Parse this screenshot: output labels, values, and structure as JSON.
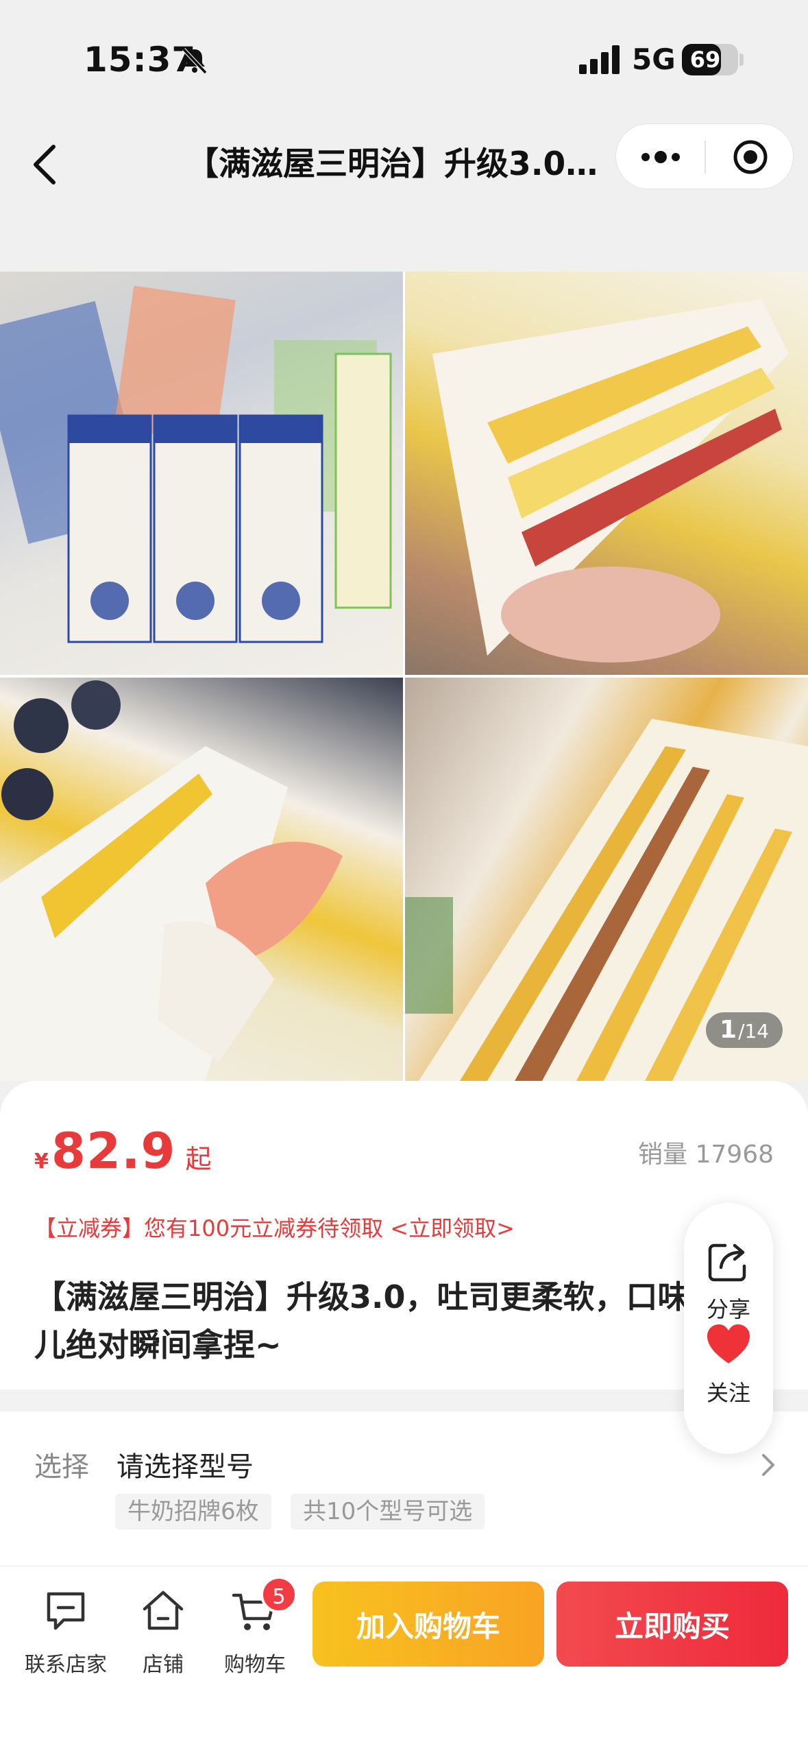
{
  "status_bar": {
    "time": "15:37",
    "network": "5G",
    "battery": "69",
    "battery_level": 0.69
  },
  "nav": {
    "title": "【满滋屋三明治】升级3.0，吐司更柔软，口味儿绝对瞬间拿捏~"
  },
  "gallery": {
    "counter_current": "1",
    "counter_total": "/14"
  },
  "product": {
    "price_symbol": "¥",
    "price": "82.9",
    "price_suffix": "起",
    "sales": "销量 17968",
    "coupon": "【立减券】您有100元立减券待领取 <立即领取>",
    "title": "【满滋屋三明治】升级3.0，吐司更柔软，口味儿绝对瞬间拿捏~"
  },
  "float_actions": {
    "share": "分享",
    "follow": "关注"
  },
  "spec": {
    "label": "选择",
    "value": "请选择型号",
    "chips": [
      "牛奶招牌6枚",
      "共10个型号可选"
    ]
  },
  "bottom_bar": {
    "contact": "联系店家",
    "store": "店铺",
    "cart": "购物车",
    "cart_badge": "5",
    "add_to_cart": "加入购物车",
    "buy_now": "立即购买"
  },
  "colors": {
    "accent_red": "#e83a3a",
    "cart_button": "#f9b724",
    "buy_button": "#f0323f"
  }
}
